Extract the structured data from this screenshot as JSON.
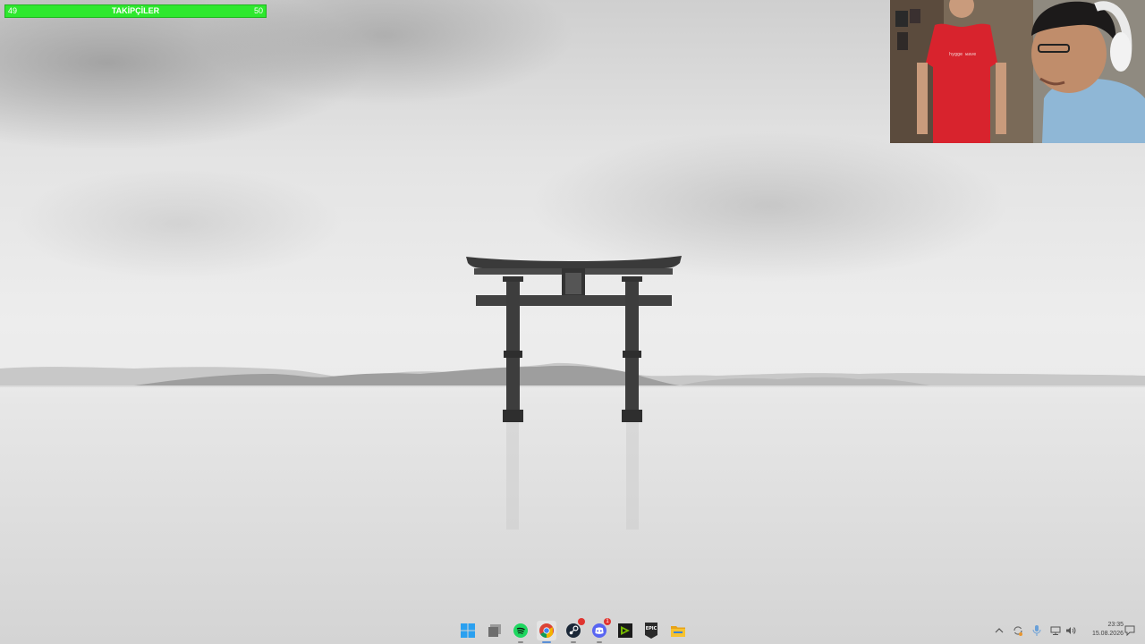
{
  "follower_goal": {
    "title": "TAKİPÇİLER",
    "current": "49",
    "target": "50",
    "progress_percent": 98,
    "color": "#2ee82e"
  },
  "webcam": {
    "shirt_text": "hygge wave"
  },
  "taskbar": {
    "pinned": [
      {
        "name": "start-icon"
      },
      {
        "name": "task-view-icon"
      },
      {
        "name": "spotify-icon"
      },
      {
        "name": "chrome-icon"
      },
      {
        "name": "steam-icon"
      },
      {
        "name": "discord-icon",
        "badge": "1"
      },
      {
        "name": "nvidia-icon"
      },
      {
        "name": "epic-games-icon",
        "label": "EPIC"
      },
      {
        "name": "file-explorer-icon"
      }
    ],
    "tray": {
      "icons": [
        "chevron-up-icon",
        "sync-icon",
        "microphone-icon",
        "network-icon",
        "volume-icon",
        "notification-icon"
      ],
      "time": "23:35",
      "date": "15.08.2026"
    }
  },
  "colors": {
    "spotify": "#1ed760",
    "discord": "#5865f2",
    "nvidia": "#76b900",
    "explorer": "#f7c22f",
    "windows": "#2aa0f0"
  }
}
